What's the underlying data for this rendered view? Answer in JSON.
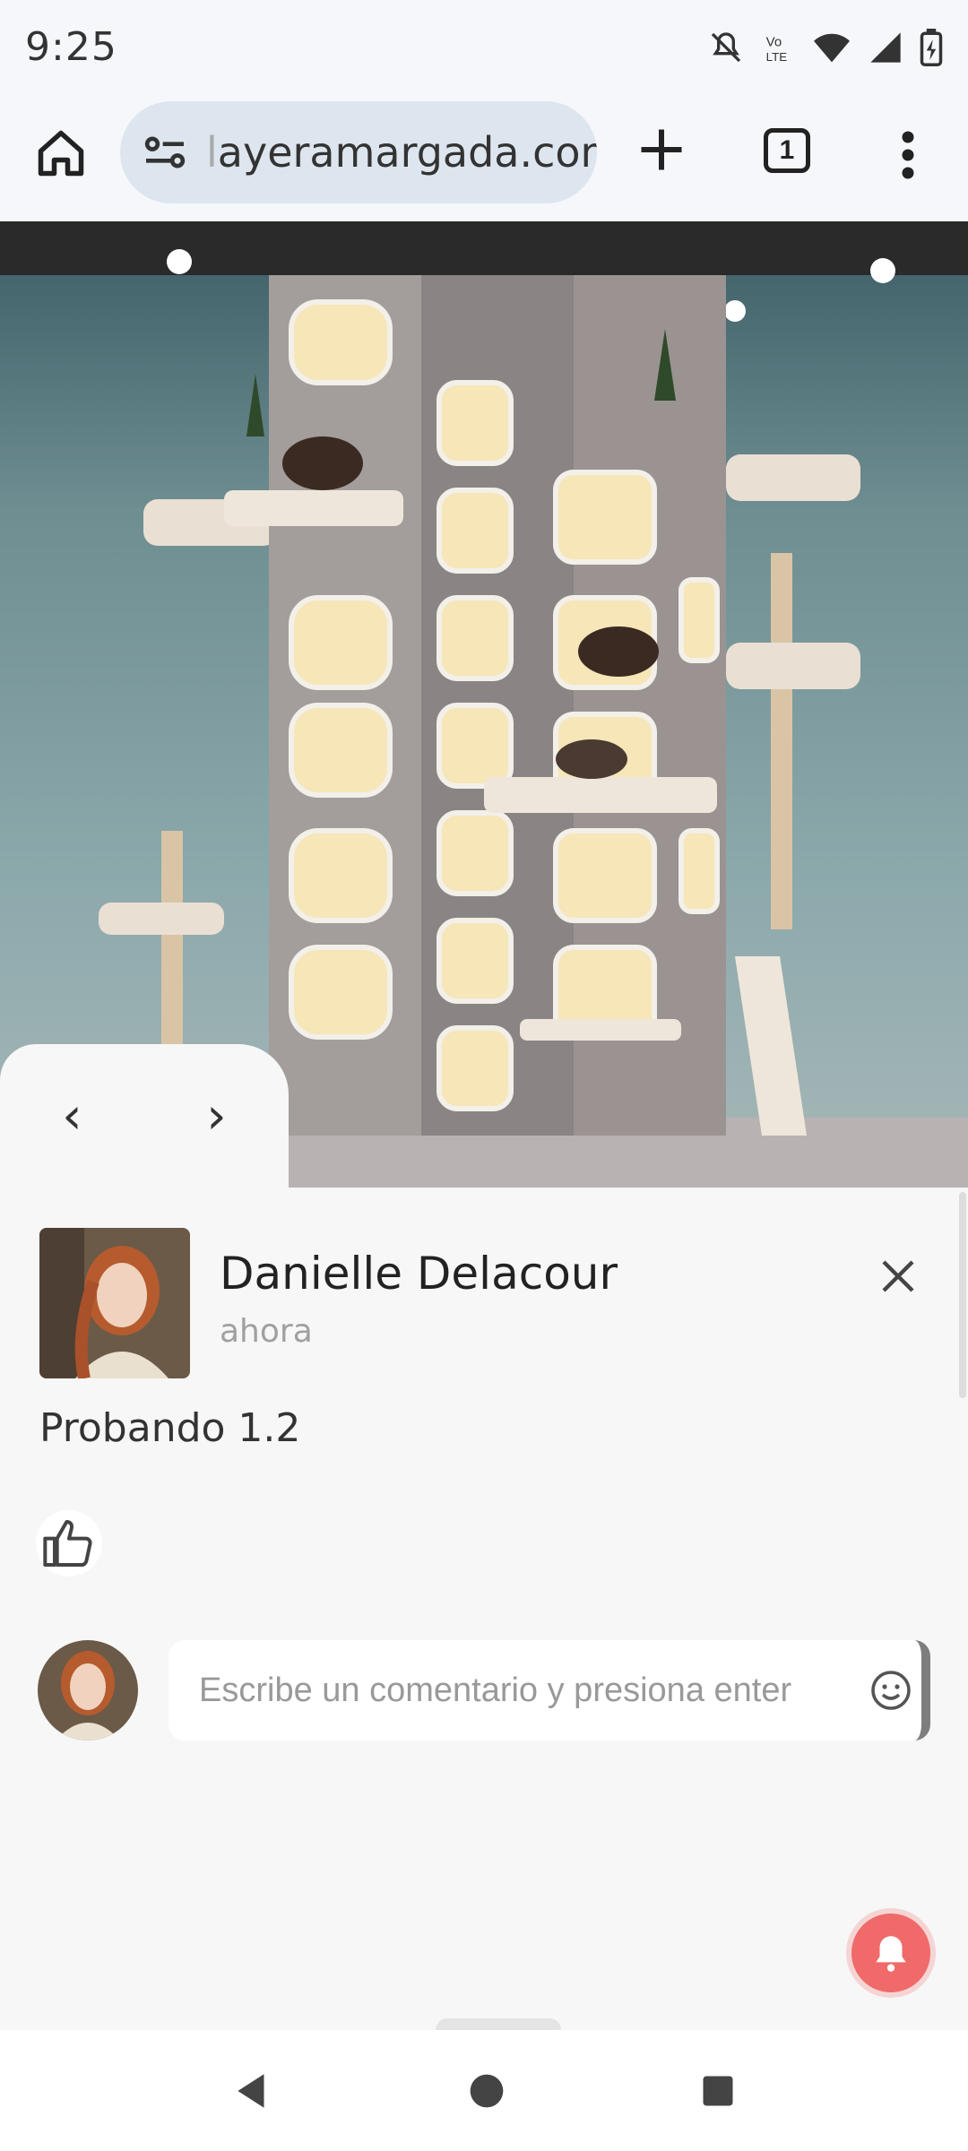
{
  "status_bar": {
    "time": "9:25",
    "icons": [
      "mute-icon",
      "volte-icon",
      "wifi-icon",
      "signal-icon",
      "battery-icon"
    ],
    "volte_label": "Vo LTE"
  },
  "browser": {
    "url_faded_prefix": "l",
    "url": "ayeramargada.com",
    "tab_count": "1"
  },
  "image_nav": {
    "prev": "‹",
    "next": "›"
  },
  "post": {
    "author": "Danielle Delacour",
    "timestamp": "ahora",
    "text": "Probando 1.2"
  },
  "comment": {
    "placeholder": "Escribe un comentario y presiona enter"
  },
  "colors": {
    "accent": "#f06a6a",
    "background": "#f7f7f7"
  }
}
